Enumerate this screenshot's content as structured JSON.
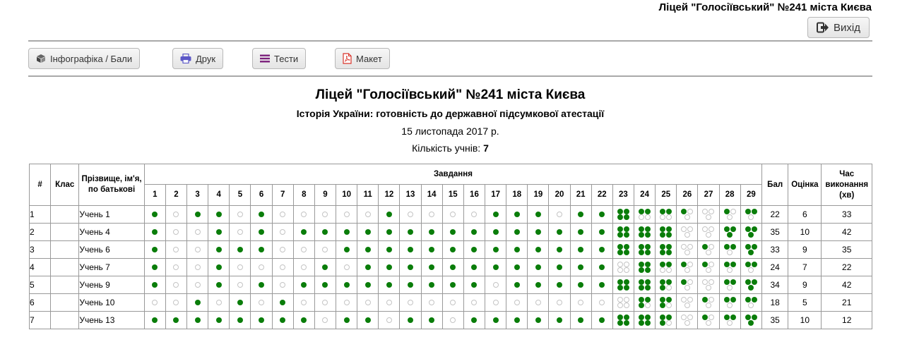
{
  "header": {
    "school_name": "Ліцей \"Голосіївський\" №241 міста Києва",
    "logout_label": "Вихід"
  },
  "toolbar": {
    "infographic_label": "Інфографіка / Бали",
    "print_label": "Друк",
    "tests_label": "Тести",
    "layout_label": "Макет"
  },
  "report": {
    "title": "Ліцей \"Голосіївський\" №241 міста Києва",
    "subject": "Історія України: готовність до державної підсумкової атестації",
    "date": "15 листопада 2017 р.",
    "count_label": "Кількість учнів:",
    "count_value": "7"
  },
  "table": {
    "col_num": "#",
    "col_class": "Клас",
    "col_name": "Прізвище, ім'я, по батькові",
    "col_tasks": "Завдання",
    "col_score": "Бал",
    "col_grade": "Оцінка",
    "col_time": "Час виконання (хв)",
    "task_numbers": [
      "1",
      "2",
      "3",
      "4",
      "5",
      "6",
      "7",
      "8",
      "9",
      "10",
      "11",
      "12",
      "13",
      "14",
      "15",
      "16",
      "17",
      "18",
      "19",
      "20",
      "21",
      "22",
      "23",
      "24",
      "25",
      "26",
      "27",
      "28",
      "29"
    ],
    "rows": [
      {
        "num": "1",
        "class": "",
        "name": "Учень 1",
        "answers": [
          1,
          0,
          1,
          1,
          0,
          1,
          0,
          0,
          0,
          0,
          0,
          1,
          0,
          0,
          0,
          0,
          1,
          1,
          1,
          0,
          1,
          1
        ],
        "multi": [
          [
            1,
            1,
            1,
            1
          ],
          [
            1,
            1,
            0,
            0
          ],
          [
            1,
            1,
            0,
            0
          ],
          [
            1,
            0,
            0
          ],
          [
            0,
            0,
            0
          ],
          [
            1,
            0,
            0
          ],
          [
            1,
            1,
            0
          ]
        ],
        "score": "22",
        "grade": "6",
        "time": "33"
      },
      {
        "num": "2",
        "class": "",
        "name": "Учень 4",
        "answers": [
          1,
          0,
          0,
          1,
          0,
          1,
          0,
          1,
          1,
          1,
          1,
          1,
          1,
          1,
          1,
          1,
          1,
          1,
          1,
          1,
          1,
          1
        ],
        "multi": [
          [
            1,
            1,
            1,
            1
          ],
          [
            1,
            1,
            1,
            1
          ],
          [
            1,
            1,
            1,
            1
          ],
          [
            0,
            0,
            0
          ],
          [
            0,
            0,
            0
          ],
          [
            1,
            1,
            1
          ],
          [
            1,
            1,
            1
          ]
        ],
        "score": "35",
        "grade": "10",
        "time": "42"
      },
      {
        "num": "3",
        "class": "",
        "name": "Учень 6",
        "answers": [
          1,
          0,
          0,
          1,
          1,
          1,
          0,
          0,
          0,
          1,
          1,
          1,
          1,
          1,
          1,
          1,
          1,
          1,
          1,
          1,
          1,
          1
        ],
        "multi": [
          [
            1,
            1,
            1,
            1
          ],
          [
            1,
            1,
            1,
            1
          ],
          [
            1,
            1,
            1,
            1
          ],
          [
            0,
            0,
            0
          ],
          [
            1,
            0,
            0
          ],
          [
            1,
            1,
            0
          ],
          [
            1,
            1,
            1
          ]
        ],
        "score": "33",
        "grade": "9",
        "time": "35"
      },
      {
        "num": "4",
        "class": "",
        "name": "Учень 7",
        "answers": [
          1,
          0,
          0,
          1,
          0,
          0,
          0,
          0,
          1,
          0,
          1,
          1,
          1,
          1,
          1,
          1,
          1,
          1,
          1,
          1,
          1,
          1
        ],
        "multi": [
          [
            0,
            0,
            0,
            0
          ],
          [
            1,
            1,
            1,
            1
          ],
          [
            1,
            1,
            0,
            0
          ],
          [
            1,
            0,
            0
          ],
          [
            1,
            0,
            0
          ],
          [
            1,
            1,
            0
          ],
          [
            1,
            1,
            0
          ]
        ],
        "score": "24",
        "grade": "7",
        "time": "22"
      },
      {
        "num": "5",
        "class": "",
        "name": "Учень 9",
        "answers": [
          1,
          0,
          0,
          1,
          0,
          1,
          0,
          1,
          1,
          1,
          1,
          1,
          1,
          1,
          1,
          1,
          0,
          1,
          1,
          1,
          1,
          1
        ],
        "multi": [
          [
            1,
            1,
            1,
            1
          ],
          [
            1,
            1,
            1,
            1
          ],
          [
            1,
            1,
            1,
            0
          ],
          [
            1,
            0,
            0
          ],
          [
            0,
            0,
            0
          ],
          [
            1,
            1,
            0
          ],
          [
            1,
            1,
            1
          ]
        ],
        "score": "34",
        "grade": "9",
        "time": "42"
      },
      {
        "num": "6",
        "class": "",
        "name": "Учень 10",
        "answers": [
          0,
          0,
          1,
          0,
          1,
          0,
          1,
          0,
          0,
          0,
          0,
          0,
          0,
          0,
          0,
          0,
          0,
          0,
          0,
          0,
          0,
          0
        ],
        "multi": [
          [
            0,
            0,
            0,
            0
          ],
          [
            1,
            1,
            1,
            0
          ],
          [
            1,
            1,
            1,
            0
          ],
          [
            0,
            0,
            0
          ],
          [
            1,
            0,
            0
          ],
          [
            1,
            1,
            0
          ],
          [
            1,
            1,
            0
          ]
        ],
        "score": "18",
        "grade": "5",
        "time": "21"
      },
      {
        "num": "7",
        "class": "",
        "name": "Учень 13",
        "answers": [
          1,
          1,
          1,
          1,
          1,
          1,
          1,
          1,
          0,
          1,
          1,
          0,
          1,
          1,
          0,
          1,
          1,
          1,
          1,
          1,
          1,
          1
        ],
        "multi": [
          [
            1,
            1,
            1,
            1
          ],
          [
            1,
            1,
            1,
            1
          ],
          [
            1,
            1,
            1,
            0
          ],
          [
            0,
            0,
            0
          ],
          [
            1,
            0,
            0
          ],
          [
            1,
            1,
            0
          ],
          [
            1,
            1,
            1
          ]
        ],
        "score": "35",
        "grade": "10",
        "time": "12"
      }
    ]
  },
  "colors": {
    "correct": "#0a7d0a",
    "empty_border": "#c4c4c4",
    "print_icon": "#5b57c7",
    "tests_icon": "#7b1f7b",
    "pdf_icon": "#d9342b"
  }
}
